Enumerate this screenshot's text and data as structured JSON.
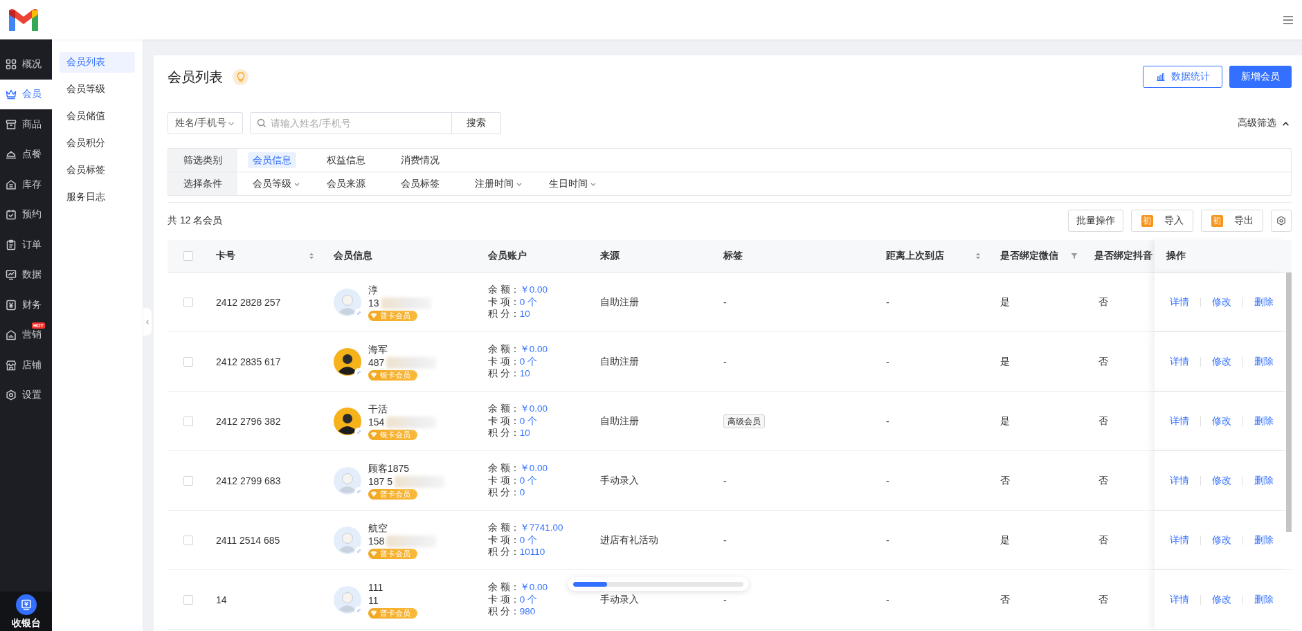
{
  "sidebar": {
    "items": [
      {
        "label": "概况",
        "kind": "grid",
        "selected": false
      },
      {
        "label": "会员",
        "kind": "crown",
        "selected": true
      },
      {
        "label": "商品",
        "kind": "box",
        "selected": false
      },
      {
        "label": "点餐",
        "kind": "cloche",
        "selected": false
      },
      {
        "label": "库存",
        "kind": "house",
        "selected": false
      },
      {
        "label": "预约",
        "kind": "calendar",
        "selected": false
      },
      {
        "label": "订单",
        "kind": "clipboard",
        "selected": false
      },
      {
        "label": "数据",
        "kind": "monitor",
        "selected": false
      },
      {
        "label": "财务",
        "kind": "yen",
        "selected": false
      },
      {
        "label": "营销",
        "kind": "bars",
        "selected": false,
        "badge": "HOT"
      },
      {
        "label": "店铺",
        "kind": "storefront",
        "selected": false
      },
      {
        "label": "设置",
        "kind": "gear",
        "selected": false
      }
    ],
    "footer": {
      "label": "收银台"
    }
  },
  "submenu": {
    "items": [
      {
        "label": "会员列表",
        "selected": true
      },
      {
        "label": "会员等级",
        "selected": false
      },
      {
        "label": "会员储值",
        "selected": false
      },
      {
        "label": "会员积分",
        "selected": false
      },
      {
        "label": "会员标签",
        "selected": false
      },
      {
        "label": "服务日志",
        "selected": false
      }
    ]
  },
  "page": {
    "title": "会员列表",
    "actions": [
      {
        "label": "数据统计",
        "kind": "outline"
      },
      {
        "label": "新增会员",
        "kind": "primary"
      }
    ]
  },
  "search": {
    "field_select": "姓名/手机号",
    "placeholder": "请输入姓名/手机号",
    "button": "搜索",
    "advanced": "高级筛选",
    "advanced_expanded": true
  },
  "filter": {
    "rows": [
      {
        "label": "筛选类别",
        "options": [
          {
            "label": "会员信息",
            "kind": "tab",
            "selected": true
          },
          {
            "label": "权益信息",
            "kind": "tab",
            "selected": false
          },
          {
            "label": "消费情况",
            "kind": "tab",
            "selected": false
          }
        ]
      },
      {
        "label": "选择条件",
        "options": [
          {
            "label": "会员等级",
            "kind": "dropdown"
          },
          {
            "label": "会员来源",
            "kind": "plain"
          },
          {
            "label": "会员标签",
            "kind": "plain"
          },
          {
            "label": "注册时间",
            "kind": "dropdown"
          },
          {
            "label": "生日时间",
            "kind": "dropdown"
          }
        ]
      }
    ]
  },
  "summary": "共 12 名会员",
  "toolbar": [
    {
      "kind": "plain",
      "label": "批量操作"
    },
    {
      "kind": "tagged",
      "tag": "初",
      "label": "导入"
    },
    {
      "kind": "tagged",
      "tag": "初",
      "label": "导出"
    },
    {
      "kind": "settings"
    }
  ],
  "table": {
    "columns": [
      {
        "kind": "check",
        "checked": false
      },
      {
        "kind": "sort",
        "label": "卡号"
      },
      {
        "kind": "plain",
        "label": "会员信息"
      },
      {
        "kind": "plain",
        "label": "会员账户"
      },
      {
        "kind": "plain",
        "label": "来源"
      },
      {
        "kind": "plain",
        "label": "标签"
      },
      {
        "kind": "sort",
        "label": "距离上次到店"
      },
      {
        "kind": "filter",
        "label": "是否绑定微信"
      },
      {
        "kind": "plain",
        "label": "是否绑定抖音"
      },
      {
        "kind": "plain",
        "label": "操作"
      }
    ],
    "rows": [
      {
        "checked": false,
        "card_no": "2412 2828 257",
        "avatar": {
          "kind": "default"
        },
        "gender": "♂",
        "name": "淳",
        "phone": "13",
        "blurred": true,
        "level": "普卡会员",
        "account": [
          {
            "label": "余 额：",
            "value": "￥0.00"
          },
          {
            "label": "卡 项：",
            "value": "0 个"
          },
          {
            "label": "积 分：",
            "value": "10"
          }
        ],
        "source": "自助注册",
        "tag": {
          "kind": "plain",
          "label": "-"
        },
        "last_visit": "-",
        "wechat": "是",
        "douyin": "否",
        "actions": [
          "详情",
          "修改",
          "删除"
        ]
      },
      {
        "checked": false,
        "card_no": "2412 2835 617",
        "avatar": {
          "kind": "photo"
        },
        "gender": "♂",
        "name": "海军",
        "phone": "487",
        "blurred": true,
        "level": "银卡会员",
        "account": [
          {
            "label": "余 额：",
            "value": "￥0.00"
          },
          {
            "label": "卡 项：",
            "value": "0 个"
          },
          {
            "label": "积 分：",
            "value": "10"
          }
        ],
        "source": "自助注册",
        "tag": {
          "kind": "plain",
          "label": "-"
        },
        "last_visit": "-",
        "wechat": "是",
        "douyin": "否",
        "actions": [
          "详情",
          "修改",
          "删除"
        ]
      },
      {
        "checked": false,
        "card_no": "2412 2796 382",
        "avatar": {
          "kind": "photo"
        },
        "gender": "♂",
        "name": "干活",
        "phone": "154",
        "blurred": true,
        "level": "银卡会员",
        "account": [
          {
            "label": "余 额：",
            "value": "￥0.00"
          },
          {
            "label": "卡 项：",
            "value": "0 个"
          },
          {
            "label": "积 分：",
            "value": "10"
          }
        ],
        "source": "自助注册",
        "tag": {
          "kind": "chip",
          "label": "高级会员"
        },
        "last_visit": "-",
        "wechat": "是",
        "douyin": "否",
        "actions": [
          "详情",
          "修改",
          "删除"
        ]
      },
      {
        "checked": false,
        "card_no": "2412 2799 683",
        "avatar": {
          "kind": "default"
        },
        "gender": "♂",
        "name": "顾客1875",
        "phone": "187 5",
        "blurred": true,
        "level": "普卡会员",
        "account": [
          {
            "label": "余 额：",
            "value": "￥0.00"
          },
          {
            "label": "卡 项：",
            "value": "0 个"
          },
          {
            "label": "积 分：",
            "value": "0"
          }
        ],
        "source": "手动录入",
        "tag": {
          "kind": "plain",
          "label": "-"
        },
        "last_visit": "-",
        "wechat": "否",
        "douyin": "否",
        "actions": [
          "详情",
          "修改",
          "删除"
        ]
      },
      {
        "checked": false,
        "card_no": "2411 2514 685",
        "avatar": {
          "kind": "default"
        },
        "gender": "♂",
        "name": "航空",
        "phone": "158",
        "blurred": true,
        "level": "普卡会员",
        "account": [
          {
            "label": "余 额：",
            "value": "￥7741.00"
          },
          {
            "label": "卡 项：",
            "value": "0 个"
          },
          {
            "label": "积 分：",
            "value": "10110"
          }
        ],
        "source": "进店有礼活动",
        "tag": {
          "kind": "plain",
          "label": "-"
        },
        "last_visit": "-",
        "wechat": "是",
        "douyin": "否",
        "actions": [
          "详情",
          "修改",
          "删除"
        ]
      },
      {
        "checked": false,
        "card_no": "14",
        "avatar": {
          "kind": "default"
        },
        "gender": "♂",
        "name": "111",
        "phone": "11",
        "blurred": false,
        "level": "普卡会员",
        "account": [
          {
            "label": "余 额：",
            "value": "￥0.00"
          },
          {
            "label": "卡 项：",
            "value": "0 个"
          },
          {
            "label": "积 分：",
            "value": "980"
          }
        ],
        "source": "手动录入",
        "tag": {
          "kind": "plain",
          "label": "-"
        },
        "last_visit": "-",
        "wechat": "否",
        "douyin": "否",
        "actions": [
          "详情",
          "修改",
          "删除"
        ]
      }
    ]
  },
  "progress": {
    "level": 0.2
  }
}
